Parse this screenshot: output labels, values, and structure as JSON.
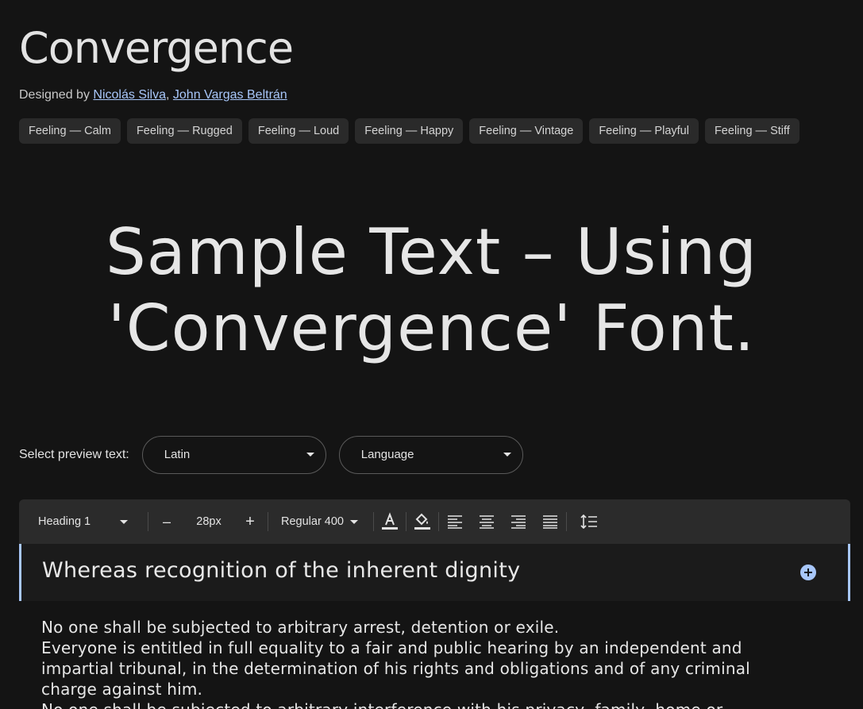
{
  "font": {
    "name": "Convergence",
    "designed_by_prefix": "Designed by",
    "designers": [
      "Nicolás Silva",
      "John Vargas Beltrán"
    ],
    "designer_separator": ","
  },
  "tags": [
    "Feeling — Calm",
    "Feeling — Rugged",
    "Feeling — Loud",
    "Feeling — Happy",
    "Feeling — Vintage",
    "Feeling — Playful",
    "Feeling — Stiff"
  ],
  "hero_text": "Sample Text – Using 'Convergence' Font.",
  "preview": {
    "label": "Select preview text:",
    "script_value": "Latin",
    "language_value": "Language"
  },
  "toolbar": {
    "style_value": "Heading 1",
    "decrease_label": "–",
    "size_value": "28px",
    "increase_label": "+",
    "weight_value": "Regular 400"
  },
  "editor": {
    "heading": "Whereas recognition of the inherent dignity",
    "paragraphs": [
      "No one shall be subjected to arbitrary arrest, detention or exile.",
      "Everyone is entitled in full equality to a fair and public hearing by an independent and impartial tribunal, in the determination of his rights and obligations and of any criminal charge against him.",
      "No one shall be subjected to arbitrary interference with his privacy, family, home or"
    ]
  },
  "colors": {
    "background": "#141414",
    "link": "#a8c7fa",
    "accent": "#a8c7fa",
    "tag_bg": "#2a2a2a",
    "toolbar_bg": "#2b2b2b"
  }
}
